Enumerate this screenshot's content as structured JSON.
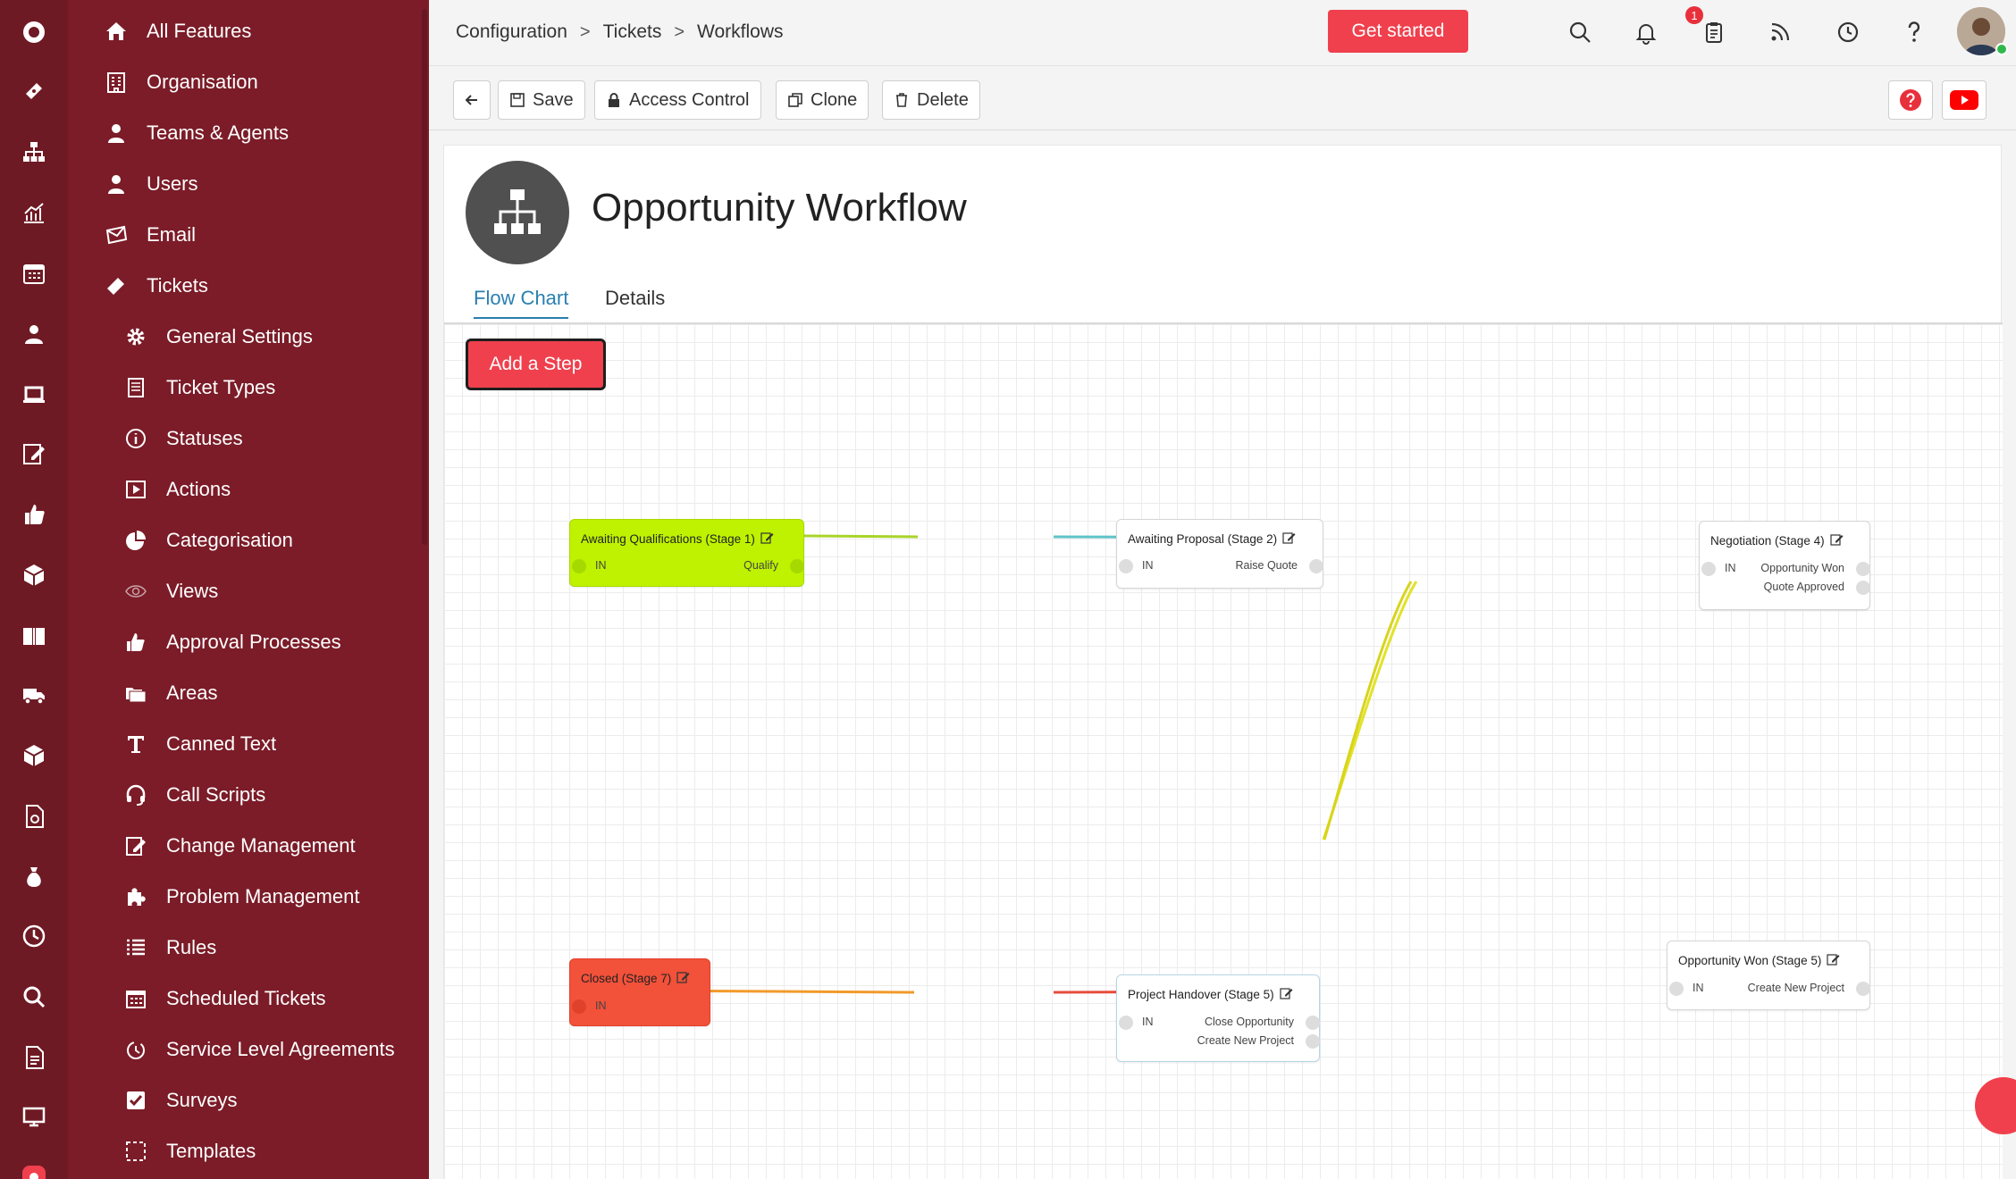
{
  "rail": {
    "icons": [
      "app-logo-icon",
      "ticket-icon",
      "org-chart-icon",
      "chart-icon",
      "calendar-icon",
      "user-icon",
      "laptop-icon",
      "edit-icon",
      "thumbs-up-icon",
      "box-icon",
      "book-icon",
      "truck-icon",
      "cube-icon",
      "document-icon",
      "money-bag-icon",
      "clock-icon",
      "search-icon",
      "file-icon",
      "monitor-icon",
      "settings-active-icon"
    ]
  },
  "sidebar": {
    "items": [
      {
        "label": "All Features",
        "icon": "home-icon",
        "level": "top"
      },
      {
        "label": "Organisation",
        "icon": "building-icon",
        "level": "top"
      },
      {
        "label": "Teams & Agents",
        "icon": "agent-icon",
        "level": "top"
      },
      {
        "label": "Users",
        "icon": "user-icon",
        "level": "top"
      },
      {
        "label": "Email",
        "icon": "email-icon",
        "level": "top"
      },
      {
        "label": "Tickets",
        "icon": "ticket-icon",
        "level": "top"
      },
      {
        "label": "General Settings",
        "icon": "gear-icon",
        "level": "sub"
      },
      {
        "label": "Ticket Types",
        "icon": "list-doc-icon",
        "level": "sub"
      },
      {
        "label": "Statuses",
        "icon": "info-icon",
        "level": "sub"
      },
      {
        "label": "Actions",
        "icon": "play-icon",
        "level": "sub"
      },
      {
        "label": "Categorisation",
        "icon": "pie-icon",
        "level": "sub"
      },
      {
        "label": "Views",
        "icon": "eye-icon",
        "level": "sub"
      },
      {
        "label": "Approval Processes",
        "icon": "thumbs-up-icon",
        "level": "sub"
      },
      {
        "label": "Areas",
        "icon": "folders-icon",
        "level": "sub"
      },
      {
        "label": "Canned Text",
        "icon": "text-icon",
        "level": "sub"
      },
      {
        "label": "Call Scripts",
        "icon": "headset-icon",
        "level": "sub"
      },
      {
        "label": "Change Management",
        "icon": "edit-doc-icon",
        "level": "sub"
      },
      {
        "label": "Problem Management",
        "icon": "puzzle-icon",
        "level": "sub"
      },
      {
        "label": "Rules",
        "icon": "rules-icon",
        "level": "sub"
      },
      {
        "label": "Scheduled Tickets",
        "icon": "calendar-grid-icon",
        "level": "sub"
      },
      {
        "label": "Service Level Agreements",
        "icon": "timer-icon",
        "level": "sub"
      },
      {
        "label": "Surveys",
        "icon": "checkbox-icon",
        "level": "sub"
      },
      {
        "label": "Templates",
        "icon": "dashed-box-icon",
        "level": "sub"
      }
    ]
  },
  "header": {
    "breadcrumb": [
      "Configuration",
      "Tickets",
      "Workflows"
    ],
    "breadcrumb_sep": ">",
    "get_started": "Get started",
    "notification_count": "1"
  },
  "toolbar": {
    "save": "Save",
    "access_control": "Access Control",
    "clone": "Clone",
    "delete": "Delete"
  },
  "workflow": {
    "title": "Opportunity Workflow",
    "tabs": [
      "Flow Chart",
      "Details"
    ],
    "active_tab": "Flow Chart",
    "add_step": "Add a Step"
  },
  "flow": {
    "nodes": [
      {
        "id": "s1",
        "title": "Awaiting Qualifications (Stage 1)",
        "color": "#bef200",
        "in": "IN",
        "outputs": [
          "Qualify"
        ]
      },
      {
        "id": "s2",
        "title": "Awaiting Proposal (Stage 2)",
        "color": "#ffffff",
        "in": "IN",
        "outputs": [
          "Raise Quote"
        ]
      },
      {
        "id": "s4",
        "title": "Negotiation (Stage 4)",
        "color": "#ffffff",
        "in": "IN",
        "outputs": [
          "Opportunity Won",
          "Quote Approved"
        ]
      },
      {
        "id": "s7",
        "title": "Closed (Stage 7)",
        "color": "#f2513a",
        "in": "IN",
        "outputs": []
      },
      {
        "id": "s5a",
        "title": "Project Handover (Stage 5)",
        "color": "#ffffff",
        "in": "IN",
        "outputs": [
          "Close Opportunity",
          "Create New Project"
        ]
      },
      {
        "id": "s5b",
        "title": "Opportunity Won (Stage 5)",
        "color": "#ffffff",
        "in": "IN",
        "outputs": [
          "Create New Project"
        ]
      }
    ],
    "links": [
      {
        "from": "s1",
        "output": "Qualify",
        "to": "s2",
        "color": "#a9d42a"
      },
      {
        "from": "s2",
        "output": "Raise Quote",
        "to": "s4",
        "color": "#5ec3c9"
      },
      {
        "from": "s4",
        "output": "Opportunity Won",
        "to": "s5b",
        "color": "#e2e22a"
      },
      {
        "from": "s4",
        "output": "Quote Approved",
        "to": "s5b",
        "color": "#d8d41c"
      },
      {
        "from": "s5b",
        "output": "Create New Project",
        "to": "s5a",
        "color": "#e84c3d"
      },
      {
        "from": "s5a",
        "output": "Close Opportunity",
        "to": "s7",
        "color": "#f19a2a"
      }
    ]
  },
  "colors": {
    "rail": "#6e1a24",
    "sidebar": "#7b1c28",
    "accent": "#f0404d",
    "tab_active": "#2a7fb0"
  }
}
